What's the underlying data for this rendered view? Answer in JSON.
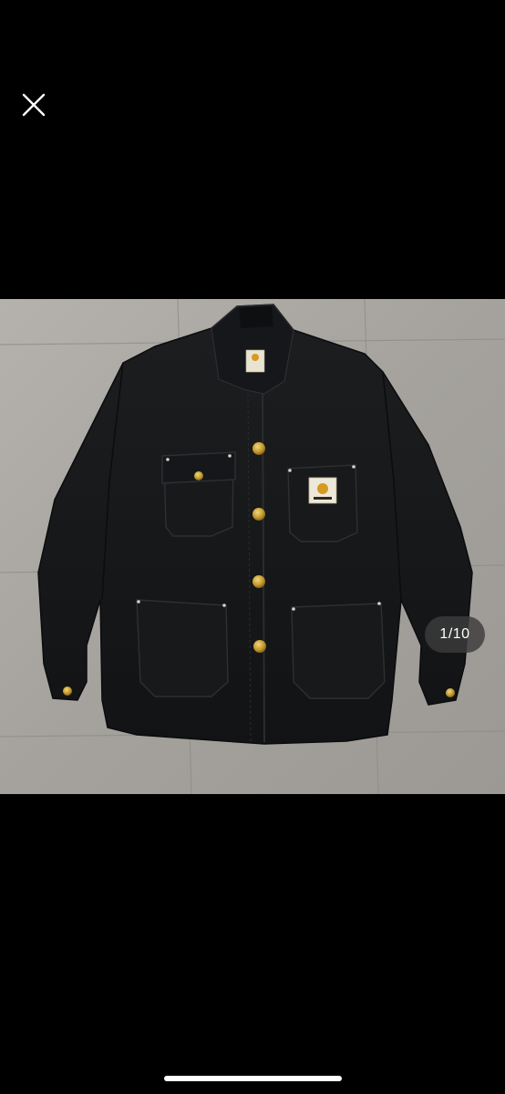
{
  "viewer": {
    "close_icon": "close-icon",
    "counter": "1/10",
    "colors": {
      "background": "#000000",
      "counter_bg": "#3c3c3c",
      "jacket": "#16181a",
      "floor": "#a9a6a1"
    }
  }
}
